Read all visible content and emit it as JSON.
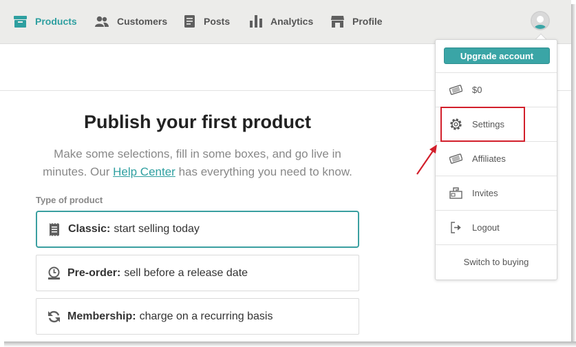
{
  "nav": {
    "items": [
      {
        "label": "Products",
        "icon": "products-icon",
        "active": true
      },
      {
        "label": "Customers",
        "icon": "customers-icon"
      },
      {
        "label": "Posts",
        "icon": "posts-icon"
      },
      {
        "label": "Analytics",
        "icon": "analytics-icon"
      },
      {
        "label": "Profile",
        "icon": "profile-icon"
      }
    ]
  },
  "main": {
    "title": "Publish your first product",
    "desc_before": "Make some selections, fill in some boxes, and go live in minutes. Our ",
    "help_link": "Help Center",
    "desc_after": " has everything you need to know.",
    "type_label": "Type of product",
    "options": [
      {
        "name": "Classic:",
        "desc": "start selling today",
        "icon": "receipt-icon",
        "selected": true
      },
      {
        "name": "Pre-order:",
        "desc": "sell before a release date",
        "icon": "alarm-clock-icon"
      },
      {
        "name": "Membership:",
        "desc": "charge on a recurring basis",
        "icon": "refresh-icon"
      }
    ]
  },
  "menu": {
    "upgrade": "Upgrade account",
    "items": [
      {
        "label": "$0",
        "icon": "ticket-icon"
      },
      {
        "label": "Settings",
        "icon": "gear-icon"
      },
      {
        "label": "Affiliates",
        "icon": "ticket-icon"
      },
      {
        "label": "Invites",
        "icon": "mailbox-icon"
      },
      {
        "label": "Logout",
        "icon": "logout-icon"
      }
    ],
    "switch": "Switch to buying"
  },
  "colors": {
    "accent": "#3aa5a6",
    "highlight": "#d21f2b",
    "nav_bg": "#ececea"
  }
}
